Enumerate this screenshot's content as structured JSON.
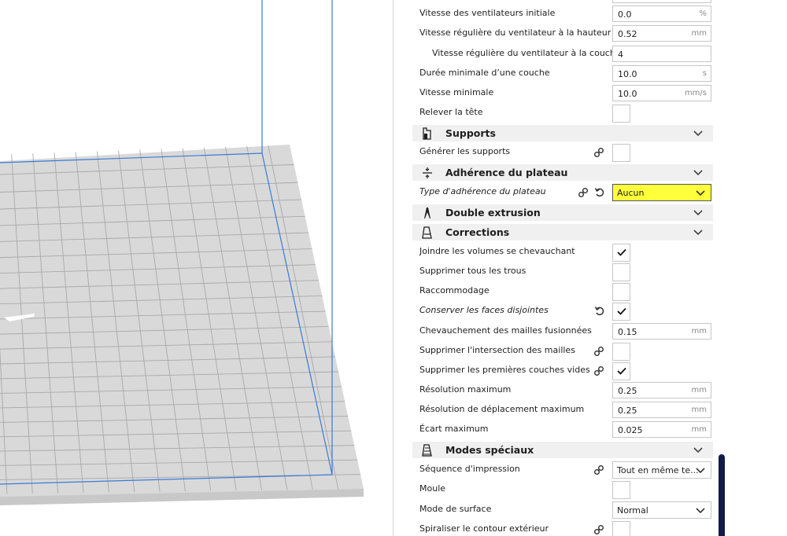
{
  "settings": {
    "fan_initial": {
      "label": "Vitesse des ventilateurs initiale",
      "value": "0.0",
      "unit": "%"
    },
    "fan_regular_height": {
      "label": "Vitesse régulière du ventilateur à la hauteur",
      "value": "0.52",
      "unit": "mm"
    },
    "fan_regular_layer": {
      "label": "Vitesse régulière du ventilateur à la couche",
      "value": "4"
    },
    "min_layer_time": {
      "label": "Durée minimale d’une couche",
      "value": "10.0",
      "unit": "s"
    },
    "min_speed": {
      "label": "Vitesse minimale",
      "value": "10.0",
      "unit": "mm/s"
    },
    "lift_head": {
      "label": "Relever la tête",
      "checked": false
    }
  },
  "categories": {
    "supports": {
      "label": "Supports",
      "icon": "support-icon"
    },
    "adhesion": {
      "label": "Adhérence du plateau",
      "icon": "adhesion-icon"
    },
    "dual": {
      "label": "Double extrusion",
      "icon": "dual-extrusion-icon"
    },
    "corrections": {
      "label": "Corrections",
      "icon": "corrections-icon"
    },
    "special": {
      "label": "Modes spéciaux",
      "icon": "special-modes-icon"
    }
  },
  "supports": {
    "generate": {
      "label": "Générer les supports",
      "checked": false
    }
  },
  "adhesion": {
    "type": {
      "label": "Type d'adhérence du plateau",
      "value": "Aucun"
    }
  },
  "corrections": {
    "union_overlap": {
      "label": "Joindre les volumes se chevauchant",
      "checked": true
    },
    "remove_holes": {
      "label": "Supprimer tous les trous",
      "checked": false
    },
    "stitching": {
      "label": "Raccommodage",
      "checked": false
    },
    "keep_open": {
      "label": "Conserver les faces disjointes",
      "checked": true
    },
    "overlap_merged": {
      "label": "Chevauchement des mailles fusionnées",
      "value": "0.15",
      "unit": "mm"
    },
    "remove_intersection": {
      "label": "Supprimer l'intersection des mailles",
      "checked": false
    },
    "remove_empty_first": {
      "label": "Supprimer les premières couches vides",
      "checked": true
    },
    "max_resolution": {
      "label": "Résolution maximum",
      "value": "0.25",
      "unit": "mm"
    },
    "max_travel_resolution": {
      "label": "Résolution de déplacement maximum",
      "value": "0.25",
      "unit": "mm"
    },
    "max_deviation": {
      "label": "Écart maximum",
      "value": "0.025",
      "unit": "mm"
    }
  },
  "special": {
    "print_sequence": {
      "label": "Séquence d'impression",
      "value": "Tout en même te..."
    },
    "mold": {
      "label": "Moule",
      "checked": false
    },
    "surface_mode": {
      "label": "Mode de surface",
      "value": "Normal"
    },
    "spiralize": {
      "label": "Spiraliser le contour extérieur",
      "checked": false
    }
  },
  "colors": {
    "highlight": "#ffff1e",
    "build_volume_outline": "#3a7bd5",
    "scrollbar": "#121c48",
    "category_bg": "#f0f0f0"
  }
}
